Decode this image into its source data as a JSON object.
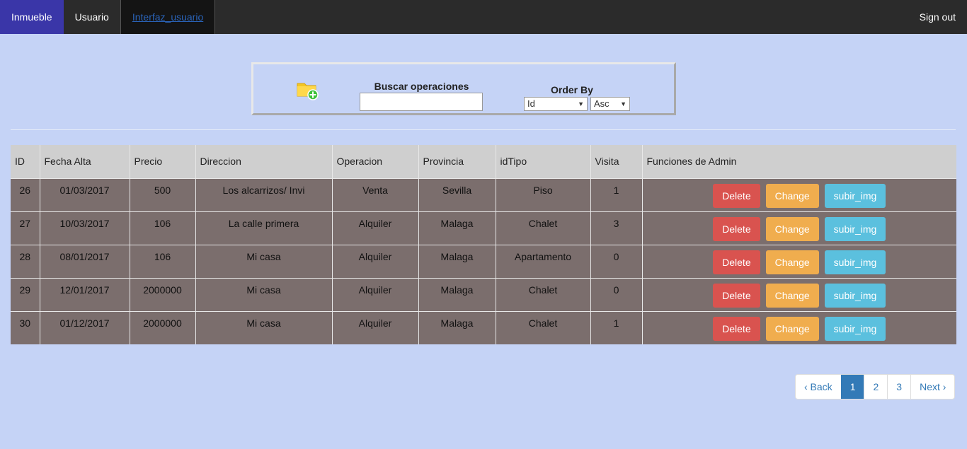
{
  "nav": {
    "tabs": [
      {
        "label": "Inmueble"
      },
      {
        "label": "Usuario"
      },
      {
        "label": "Interfaz_usuario"
      }
    ],
    "signout": "Sign out"
  },
  "search": {
    "label": "Buscar operaciones",
    "value": "",
    "placeholder": "",
    "order_label": "Order By",
    "order_field": "Id",
    "order_dir": "Asc",
    "add_icon": "folder-add-icon"
  },
  "table": {
    "headers": [
      "ID",
      "Fecha Alta",
      "Precio",
      "Direccion",
      "Operacion",
      "Provincia",
      "idTipo",
      "Visita",
      "Funciones de Admin"
    ],
    "rows": [
      {
        "id": "26",
        "fecha": "01/03/2017",
        "precio": "500",
        "direccion": "Los alcarrizos/ Invi",
        "operacion": "Venta",
        "provincia": "Sevilla",
        "tipo": "Piso",
        "visita": "1"
      },
      {
        "id": "27",
        "fecha": "10/03/2017",
        "precio": "106",
        "direccion": "La calle primera",
        "operacion": "Alquiler",
        "provincia": "Malaga",
        "tipo": "Chalet",
        "visita": "3"
      },
      {
        "id": "28",
        "fecha": "08/01/2017",
        "precio": "106",
        "direccion": "Mi casa",
        "operacion": "Alquiler",
        "provincia": "Malaga",
        "tipo": "Apartamento",
        "visita": "0"
      },
      {
        "id": "29",
        "fecha": "12/01/2017",
        "precio": "2000000",
        "direccion": "Mi casa",
        "operacion": "Alquiler",
        "provincia": "Malaga",
        "tipo": "Chalet",
        "visita": "0"
      },
      {
        "id": "30",
        "fecha": "01/12/2017",
        "precio": "2000000",
        "direccion": "Mi casa",
        "operacion": "Alquiler",
        "provincia": "Malaga",
        "tipo": "Chalet",
        "visita": "1"
      }
    ],
    "actions": {
      "delete": "Delete",
      "change": "Change",
      "upload": "subir_img"
    }
  },
  "pagination": {
    "back": "‹ Back",
    "pages": [
      "1",
      "2",
      "3"
    ],
    "current": "1",
    "next": "Next ›"
  },
  "colors": {
    "background": "#c5d3f6",
    "nav": "#2b2b2b",
    "active_tab": "#3a36a8",
    "row": "#7b6e6d",
    "header": "#cfcfcf",
    "delete": "#d9534f",
    "change": "#f0ad4e",
    "upload": "#5bc0de",
    "pager_active": "#337ab7"
  }
}
